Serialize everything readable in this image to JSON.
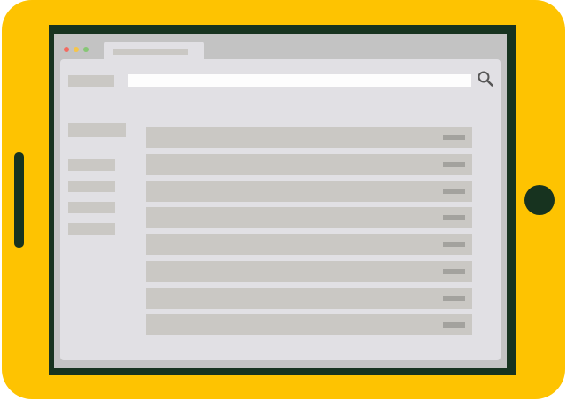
{
  "device": {
    "type": "tablet",
    "colors": {
      "frame": "#fec301",
      "bezel": "#17331f",
      "screen_background": "#c3c3c3",
      "page_background": "#e1e0e4",
      "placeholder_block": "#cac8c4",
      "row_badge": "#a3a29e",
      "search_field": "#fdfdfd"
    },
    "home_button_icon": "circle-home-button",
    "side_button_icon": "rounded-side-button"
  },
  "browser": {
    "window_controls": [
      {
        "name": "close",
        "color": "#f26b60"
      },
      {
        "name": "minimize",
        "color": "#f5c54a"
      },
      {
        "name": "maximize",
        "color": "#86c675"
      }
    ],
    "tab": {
      "title": ""
    },
    "search": {
      "value": "",
      "placeholder": "",
      "icon": "search-icon"
    }
  },
  "sidebar": {
    "heading": "",
    "items": [
      {
        "label": ""
      },
      {
        "label": ""
      },
      {
        "label": ""
      },
      {
        "label": ""
      }
    ]
  },
  "list": {
    "rows": [
      {
        "label": ""
      },
      {
        "label": ""
      },
      {
        "label": ""
      },
      {
        "label": ""
      },
      {
        "label": ""
      },
      {
        "label": ""
      },
      {
        "label": ""
      },
      {
        "label": ""
      }
    ]
  }
}
